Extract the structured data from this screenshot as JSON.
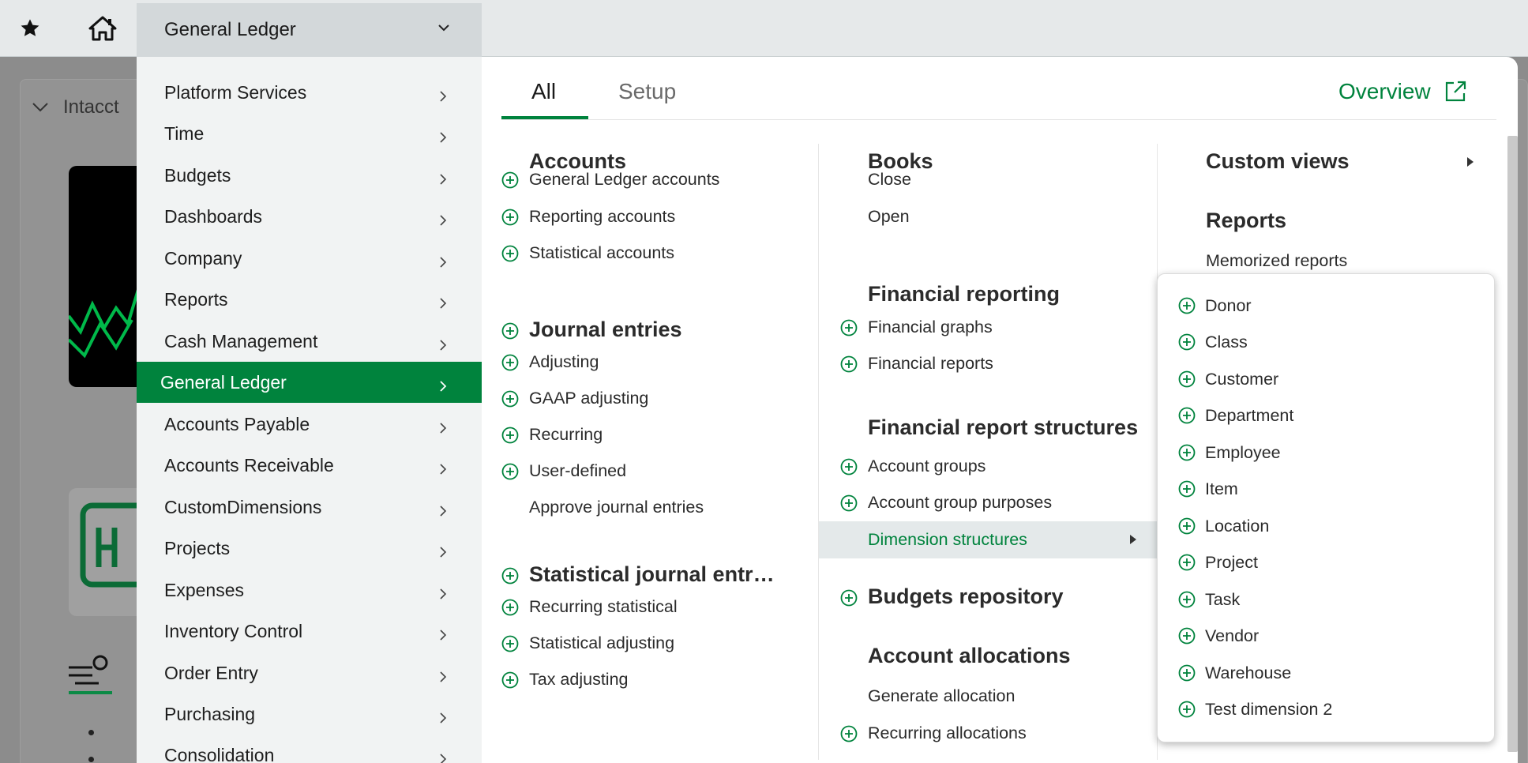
{
  "topbar": {
    "module_selector": "General Ledger",
    "star_icon": "star-icon",
    "home_icon": "home-icon"
  },
  "background": {
    "title": "Intacct"
  },
  "left_menu": {
    "items": [
      {
        "label": "Platform Services"
      },
      {
        "label": "Time"
      },
      {
        "label": "Budgets"
      },
      {
        "label": "Dashboards"
      },
      {
        "label": "Company"
      },
      {
        "label": "Reports"
      },
      {
        "label": "Cash Management"
      },
      {
        "label": "General Ledger",
        "active": true
      },
      {
        "label": "Accounts Payable"
      },
      {
        "label": "Accounts Receivable"
      },
      {
        "label": "CustomDimensions"
      },
      {
        "label": "Projects"
      },
      {
        "label": "Expenses"
      },
      {
        "label": "Inventory Control"
      },
      {
        "label": "Order Entry"
      },
      {
        "label": "Purchasing"
      },
      {
        "label": "Consolidation"
      }
    ]
  },
  "panel": {
    "tabs": [
      {
        "label": "All",
        "active": true
      },
      {
        "label": "Setup"
      }
    ],
    "overview_label": "Overview",
    "col1": {
      "accounts": {
        "heading": "Accounts",
        "items": [
          "General Ledger accounts",
          "Reporting accounts",
          "Statistical accounts"
        ]
      },
      "journal_entries": {
        "heading": "Journal entries",
        "items": [
          "Adjusting",
          "GAAP adjusting",
          "Recurring",
          "User-defined",
          "Approve journal entries"
        ]
      },
      "statistical": {
        "heading": "Statistical journal entr…",
        "items": [
          "Recurring statistical",
          "Statistical adjusting",
          "Tax adjusting"
        ]
      }
    },
    "col2": {
      "books": {
        "heading": "Books",
        "items": [
          "Close",
          "Open"
        ]
      },
      "financial_reporting": {
        "heading": "Financial reporting",
        "items": [
          "Financial graphs",
          "Financial reports"
        ]
      },
      "report_structures": {
        "heading": "Financial report structures",
        "items": [
          "Account groups",
          "Account group purposes",
          "Dimension structures"
        ]
      },
      "budgets_repository": {
        "heading": "Budgets repository"
      },
      "account_allocations": {
        "heading": "Account allocations",
        "items": [
          "Generate allocation",
          "Recurring allocations"
        ]
      }
    },
    "col3": {
      "custom_views": "Custom views",
      "reports": {
        "heading": "Reports",
        "items": [
          "Memorized reports"
        ]
      }
    }
  },
  "submenu": {
    "items": [
      "Donor",
      "Class",
      "Customer",
      "Department",
      "Employee",
      "Item",
      "Location",
      "Project",
      "Task",
      "Vendor",
      "Warehouse",
      "Test dimension 2"
    ]
  },
  "colors": {
    "accent": "#00833d",
    "topbar_bg": "#e6e9ea",
    "menu_bg": "#f1f3f3"
  }
}
